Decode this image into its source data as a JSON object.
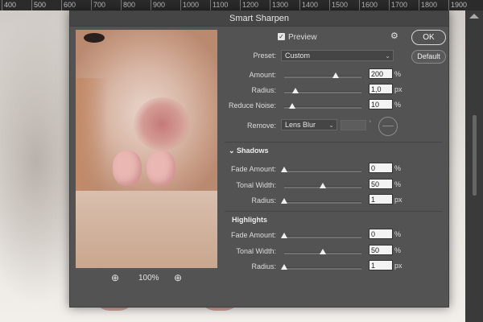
{
  "ruler": {
    "ticks": [
      "400",
      "500",
      "600",
      "700",
      "800",
      "900",
      "1000",
      "1100",
      "1200",
      "1300",
      "1400",
      "1500",
      "1600",
      "1700",
      "1800",
      "1900"
    ]
  },
  "dialog": {
    "title": "Smart Sharpen",
    "preview_label": "Preview",
    "preview_checked": true,
    "ok_label": "OK",
    "default_label": "Default",
    "zoom_level": "100%",
    "preset": {
      "label": "Preset:",
      "value": "Custom"
    },
    "amount": {
      "label": "Amount:",
      "value": "200",
      "unit": "%",
      "level": 0.67
    },
    "radius": {
      "label": "Radius:",
      "value": "1,0",
      "unit": "px",
      "level": 0.15
    },
    "reduce_noise": {
      "label": "Reduce Noise:",
      "value": "10",
      "unit": "%",
      "level": 0.1
    },
    "remove": {
      "label": "Remove:",
      "value": "Lens Blur",
      "angle_unit": "°"
    },
    "shadows": {
      "title": "Shadows",
      "fade_amount": {
        "label": "Fade Amount:",
        "value": "0",
        "unit": "%",
        "level": 0.0
      },
      "tonal_width": {
        "label": "Tonal Width:",
        "value": "50",
        "unit": "%",
        "level": 0.5
      },
      "radius": {
        "label": "Radius:",
        "value": "1",
        "unit": "px",
        "level": 0.0
      }
    },
    "highlights": {
      "title": "Highlights",
      "fade_amount": {
        "label": "Fade Amount:",
        "value": "0",
        "unit": "%",
        "level": 0.0
      },
      "tonal_width": {
        "label": "Tonal Width:",
        "value": "50",
        "unit": "%",
        "level": 0.5
      },
      "radius": {
        "label": "Radius:",
        "value": "1",
        "unit": "px",
        "level": 0.0
      }
    }
  },
  "icons": {
    "zoom_out": "zoom-out-icon",
    "zoom_in": "zoom-in-icon",
    "gear": "gear-icon",
    "collapse": "chevron-down-icon"
  },
  "colors": {
    "dialog_bg": "#535353",
    "titlebar": "#454545",
    "field_bg": "#f3f3f3",
    "text": "#dcdcdc"
  }
}
